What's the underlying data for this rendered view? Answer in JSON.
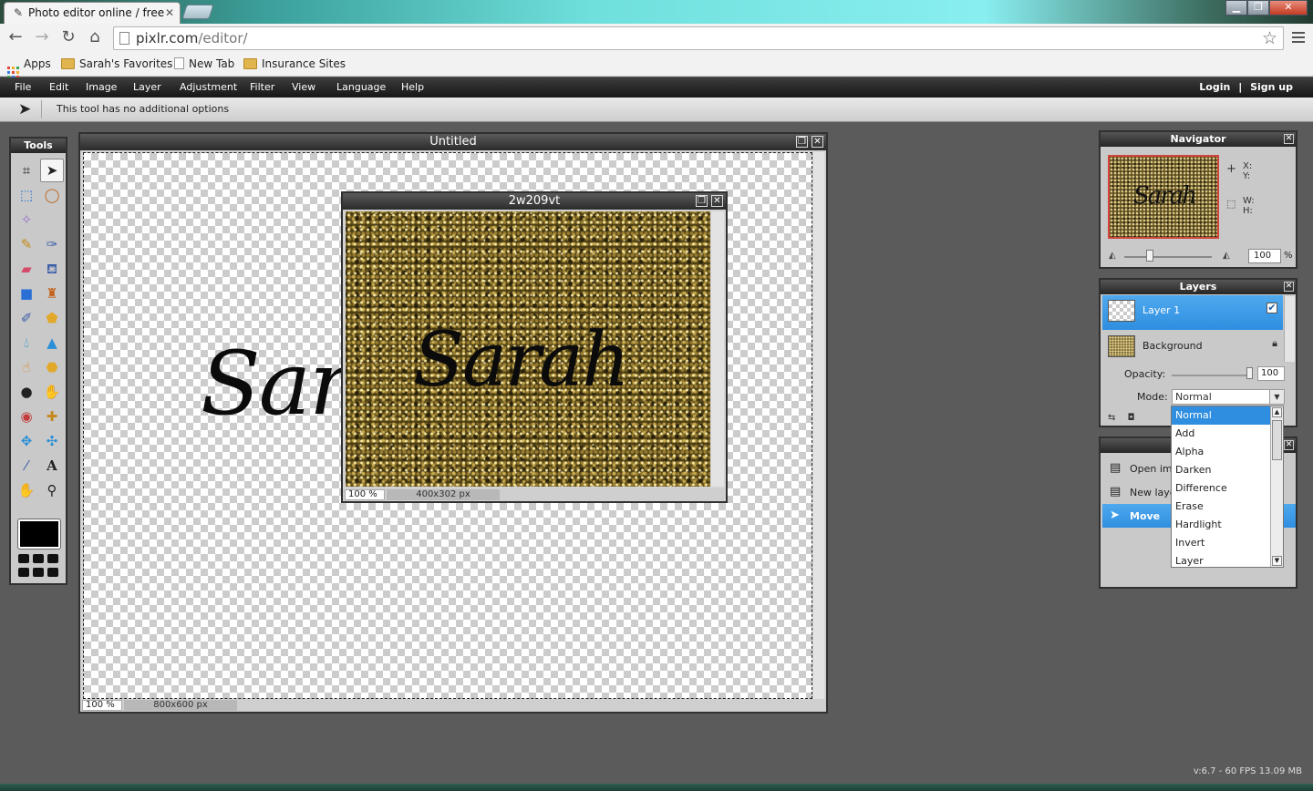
{
  "browser": {
    "tab_title": "Photo editor online / free",
    "url_host": "pixlr.com",
    "url_path": "/editor/",
    "bookmarks": [
      "Apps",
      "Sarah's Favorites",
      "New Tab",
      "Insurance Sites"
    ]
  },
  "menu": {
    "items": [
      "File",
      "Edit",
      "Image",
      "Layer",
      "Adjustment",
      "Filter",
      "View",
      "Language",
      "Help"
    ],
    "login": "Login",
    "separator": "|",
    "signup": "Sign up"
  },
  "options_bar": {
    "message": "This tool has no additional options"
  },
  "tools_panel": {
    "title": "Tools"
  },
  "documents": {
    "untitled": {
      "title": "Untitled",
      "zoom": "100 %",
      "size": "800x600 px",
      "text": "Sarah"
    },
    "glitter": {
      "title": "2w209vt",
      "zoom": "100 %",
      "size": "400x302 px",
      "text": "Sarah"
    }
  },
  "navigator": {
    "title": "Navigator",
    "x_label": "X:",
    "y_label": "Y:",
    "w_label": "W:",
    "h_label": "H:",
    "zoom": "100",
    "zoom_unit": "%",
    "thumb_text": "Sarah"
  },
  "layers": {
    "title": "Layers",
    "items": [
      {
        "name": "Layer 1",
        "selected": true,
        "visible": true
      },
      {
        "name": "Background",
        "selected": false,
        "locked": true
      }
    ],
    "opacity_label": "Opacity:",
    "opacity": "100",
    "mode_label": "Mode:",
    "mode": "Normal"
  },
  "history": {
    "items": [
      "Open ima",
      "New laye",
      "Move"
    ]
  },
  "mode_options": [
    "Normal",
    "Add",
    "Alpha",
    "Darken",
    "Difference",
    "Erase",
    "Hardlight",
    "Invert",
    "Layer"
  ],
  "status": {
    "version": "v:6.7 - 60 FPS 13.09 MB"
  }
}
